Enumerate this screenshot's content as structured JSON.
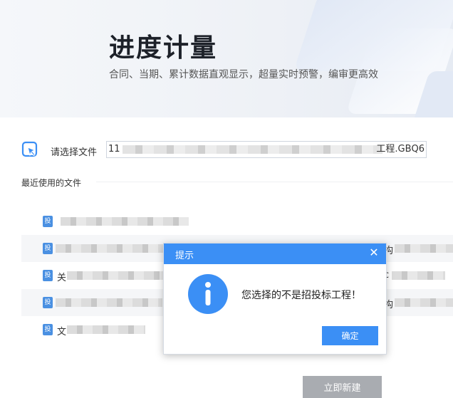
{
  "hero": {
    "title": "进度计量",
    "subtitle": "合同、当期、累计数据直观显示，超量实时预警，编审更高效"
  },
  "file_select": {
    "label": "请选择文件",
    "value_prefix": "11",
    "value_suffix": "工程.GBQ6"
  },
  "recent": {
    "title": "最近使用的文件",
    "icon_text": "投",
    "rows": [
      {
        "prefix": "",
        "right": ""
      },
      {
        "prefix": "",
        "right": "构"
      },
      {
        "prefix": "关",
        "right": "c"
      },
      {
        "prefix": "",
        "right": "构"
      },
      {
        "prefix": "文",
        "right": ""
      }
    ]
  },
  "new_button": "立即新建",
  "dialog": {
    "title": "提示",
    "close_glyph": "✕",
    "message": "您选择的不是招投标工程！",
    "ok_label": "确定"
  },
  "colors": {
    "accent": "#3b8ff5",
    "disabled_button": "#a9acb1"
  }
}
